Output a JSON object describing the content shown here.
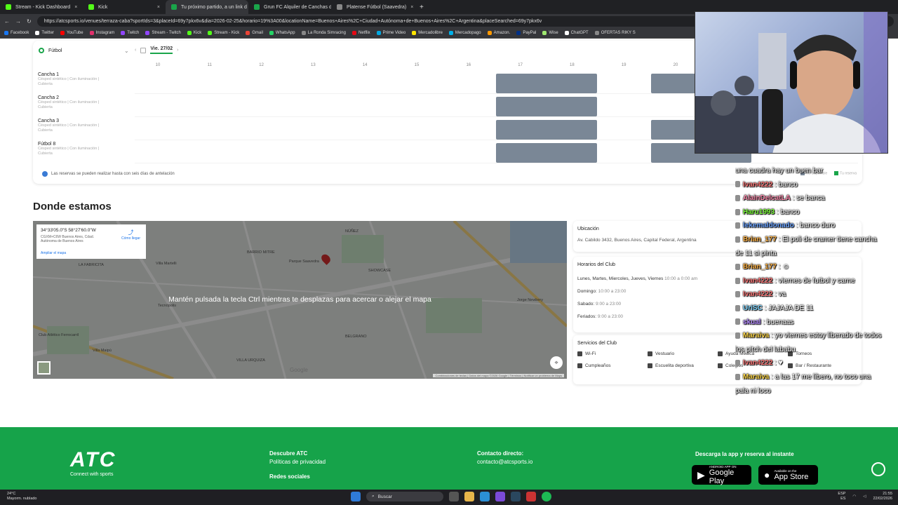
{
  "browser": {
    "tabs": [
      {
        "title": "Stream - Kick Dashboard",
        "icon": "kick-icon",
        "color": "#53fc18",
        "active": false
      },
      {
        "title": "Kick",
        "icon": "kick-icon",
        "color": "#53fc18",
        "active": false
      },
      {
        "title": "Tu próximo partido, a un link d",
        "icon": "atc-icon",
        "color": "#1aa54a",
        "active": true
      },
      {
        "title": "Grun FC Alquiler de Canchas de F",
        "icon": "atc-icon",
        "color": "#1aa54a",
        "active": false
      },
      {
        "title": "Platense Fútbol (Saavedra)",
        "icon": "globe-icon",
        "color": "#888888",
        "active": false
      }
    ],
    "new_tab": "+",
    "url": "https://atcsports.io/venues/terraza-caba?sportIds=3&placeId=69y7pkx6v&dia=2026-02-25&horario=19%3A00&locationName=Buenos+Aires%2C+Ciudad+Autónoma+de+Buenos+Aires%2C+Argentina&placeSearched=69y7pkx6v",
    "bookmarks": [
      {
        "label": "Facebook",
        "color": "#1877f2"
      },
      {
        "label": "Twitter",
        "color": "#ffffff"
      },
      {
        "label": "YouTube",
        "color": "#ff0000"
      },
      {
        "label": "Instagram",
        "color": "#e1306c"
      },
      {
        "label": "Twitch",
        "color": "#9146ff"
      },
      {
        "label": "Stream - Twitch",
        "color": "#9146ff"
      },
      {
        "label": "Kick",
        "color": "#53fc18"
      },
      {
        "label": "Stream - Kick",
        "color": "#53fc18"
      },
      {
        "label": "Gmail",
        "color": "#ea4335"
      },
      {
        "label": "WhatsApp",
        "color": "#25d366"
      },
      {
        "label": "La Ronda Simracing",
        "color": "#888888"
      },
      {
        "label": "Netflix",
        "color": "#e50914"
      },
      {
        "label": "Prime Video",
        "color": "#00a8e1"
      },
      {
        "label": "Mercadolibre",
        "color": "#ffe600"
      },
      {
        "label": "Mercadopago",
        "color": "#00b1ea"
      },
      {
        "label": "Amazon.",
        "color": "#ff9900"
      },
      {
        "label": "PayPal",
        "color": "#003087"
      },
      {
        "label": "Wise",
        "color": "#9fe870"
      },
      {
        "label": "ChatGPT",
        "color": "#ffffff"
      },
      {
        "label": "OFERTAS RIKY S",
        "color": "#888888"
      }
    ]
  },
  "schedule": {
    "sport": "Fútbol",
    "date": "Vie. 27/02",
    "hours": [
      "10",
      "11",
      "12",
      "13",
      "14",
      "15",
      "16",
      "17",
      "18",
      "19",
      "20"
    ],
    "courts": [
      {
        "name": "Cancha 1",
        "desc1": "Césped sintético | Con iluminación |",
        "desc2": "Cubierta"
      },
      {
        "name": "Cancha 2",
        "desc1": "Césped sintético | Con iluminación |",
        "desc2": "Cubierta"
      },
      {
        "name": "Cancha 3",
        "desc1": "Césped sintético | Con iluminación |",
        "desc2": "Cubierta"
      },
      {
        "name": "Fútbol 8",
        "desc1": "Césped sintético | Con iluminación |",
        "desc2": "Cubierta"
      }
    ],
    "note": "Las reservas se pueden realizar hasta con seis días de antelación",
    "legend": {
      "unavailable": "No disponible",
      "yours": "Tu reserva"
    },
    "unavailable_color": "#7a8796"
  },
  "location": {
    "title": "Donde estamos",
    "map": {
      "coords": "34°33'05.0\"S 58°27'60.0\"W",
      "plus_code": "CGXM+C6W Buenos Aires, Cdad. Autónoma de Buenos Aires",
      "enlarge": "Ampliar el mapa",
      "directions": "Cómo llegar",
      "ctrl_message": "Mantén pulsada la tecla Ctrl mientras te desplazas para acercar o alejar el mapa",
      "labels": [
        "Villa Martelli",
        "LA FABRICITA",
        "BARRIO MITRE",
        "NÚÑEZ",
        "Tecnópolis",
        "Parque Saavedra",
        "SHOWCASE",
        "BELGRANO",
        "Club Atlético Ferrocarril",
        "Villa Maipú",
        "VILLA URQUIZA",
        "Jorge Newbery"
      ],
      "attribution": "Combinaciones de teclas | Datos del mapa ©2026 Google | Términos | Notificar un problema de Maps",
      "google": "Google"
    },
    "address_title": "Ubicación",
    "address": "Av. Cabildo 3432, Buenos Aires, Capital Federal, Argentina",
    "hours_title": "Horarios del Club",
    "hours": [
      {
        "day": "Lunes, Martes, Miercoles, Jueves, Viernes",
        "time": "10:00 a 0:00 am"
      },
      {
        "day": "Domingo:",
        "time": "10:00 a 23:00"
      },
      {
        "day": "Sabado:",
        "time": "9:00 a 23:00"
      },
      {
        "day": "Feriados:",
        "time": "9:00 a 23:00"
      }
    ],
    "services_title": "Servicios del Club",
    "services": [
      "Wi-Fi",
      "Vestuario",
      "Ayuda Médica",
      "Torneos",
      "Cumpleaños",
      "Escuelita deportiva",
      "Colegios",
      "Bar / Restaurante"
    ]
  },
  "footer": {
    "logo": "ATC",
    "tagline": "Connect with sports",
    "discover_title": "Descubre ATC",
    "privacy": "Políticas de privacidad",
    "social_title": "Redes sociales",
    "contact_title": "Contacto directo:",
    "contact_email": "contacto@atcsports.io",
    "download_title": "Descarga la app y reserva al instante",
    "google_play_small": "ANDROID APP ON",
    "google_play": "Google Play",
    "app_store_small": "Available on the",
    "app_store": "App Store",
    "brand_color": "#16a34a"
  },
  "chat": [
    {
      "user": "",
      "text": "una cuadra hay un buen bar",
      "color": "#ffffff"
    },
    {
      "user": "Ivan4222",
      "text": " : banco",
      "color": "#ff7a7a"
    },
    {
      "user": "AlainDelcatLA",
      "text": " : se banca",
      "color": "#ff8fb0"
    },
    {
      "user": "Haru1993",
      "text": " : banco",
      "color": "#7cfc3a"
    },
    {
      "user": "lekemaldonado",
      "text": " : banco duro",
      "color": "#6aa3ff"
    },
    {
      "user": "Brian_177",
      "text": " : El poli de cramer tiene cancha de 11 si pinta",
      "color": "#ffb347"
    },
    {
      "user": "Brian_177",
      "text": " : ☺",
      "color": "#ffb347"
    },
    {
      "user": "Ivan4222",
      "text": " : viernes de futbol y carne",
      "color": "#ff7a7a"
    },
    {
      "user": "Ivan4222",
      "text": " : va",
      "color": "#ff7a7a"
    },
    {
      "user": "UriSC",
      "text": " : JAJAJA DE 11",
      "color": "#7cd4ff"
    },
    {
      "user": "skual",
      "text": " : buenaas",
      "color": "#b58cff"
    },
    {
      "user": "Maraiva",
      "text": " : yo viernes estoy liberado de todos los pitch del lababu",
      "color": "#ffd84a"
    },
    {
      "user": "Ivan4222",
      "text": " : ♥",
      "color": "#ff7a7a"
    },
    {
      "user": "Maraiva",
      "text": " : a las 17 me libero, no toco una pala ni loco",
      "color": "#ffd84a"
    }
  ],
  "taskbar": {
    "temp": "24°C",
    "weather": "Mayorm. nublado",
    "search": "Buscar",
    "lang1": "ESP",
    "lang2": "ES",
    "time": "21:55",
    "date": "22/02/2026"
  }
}
